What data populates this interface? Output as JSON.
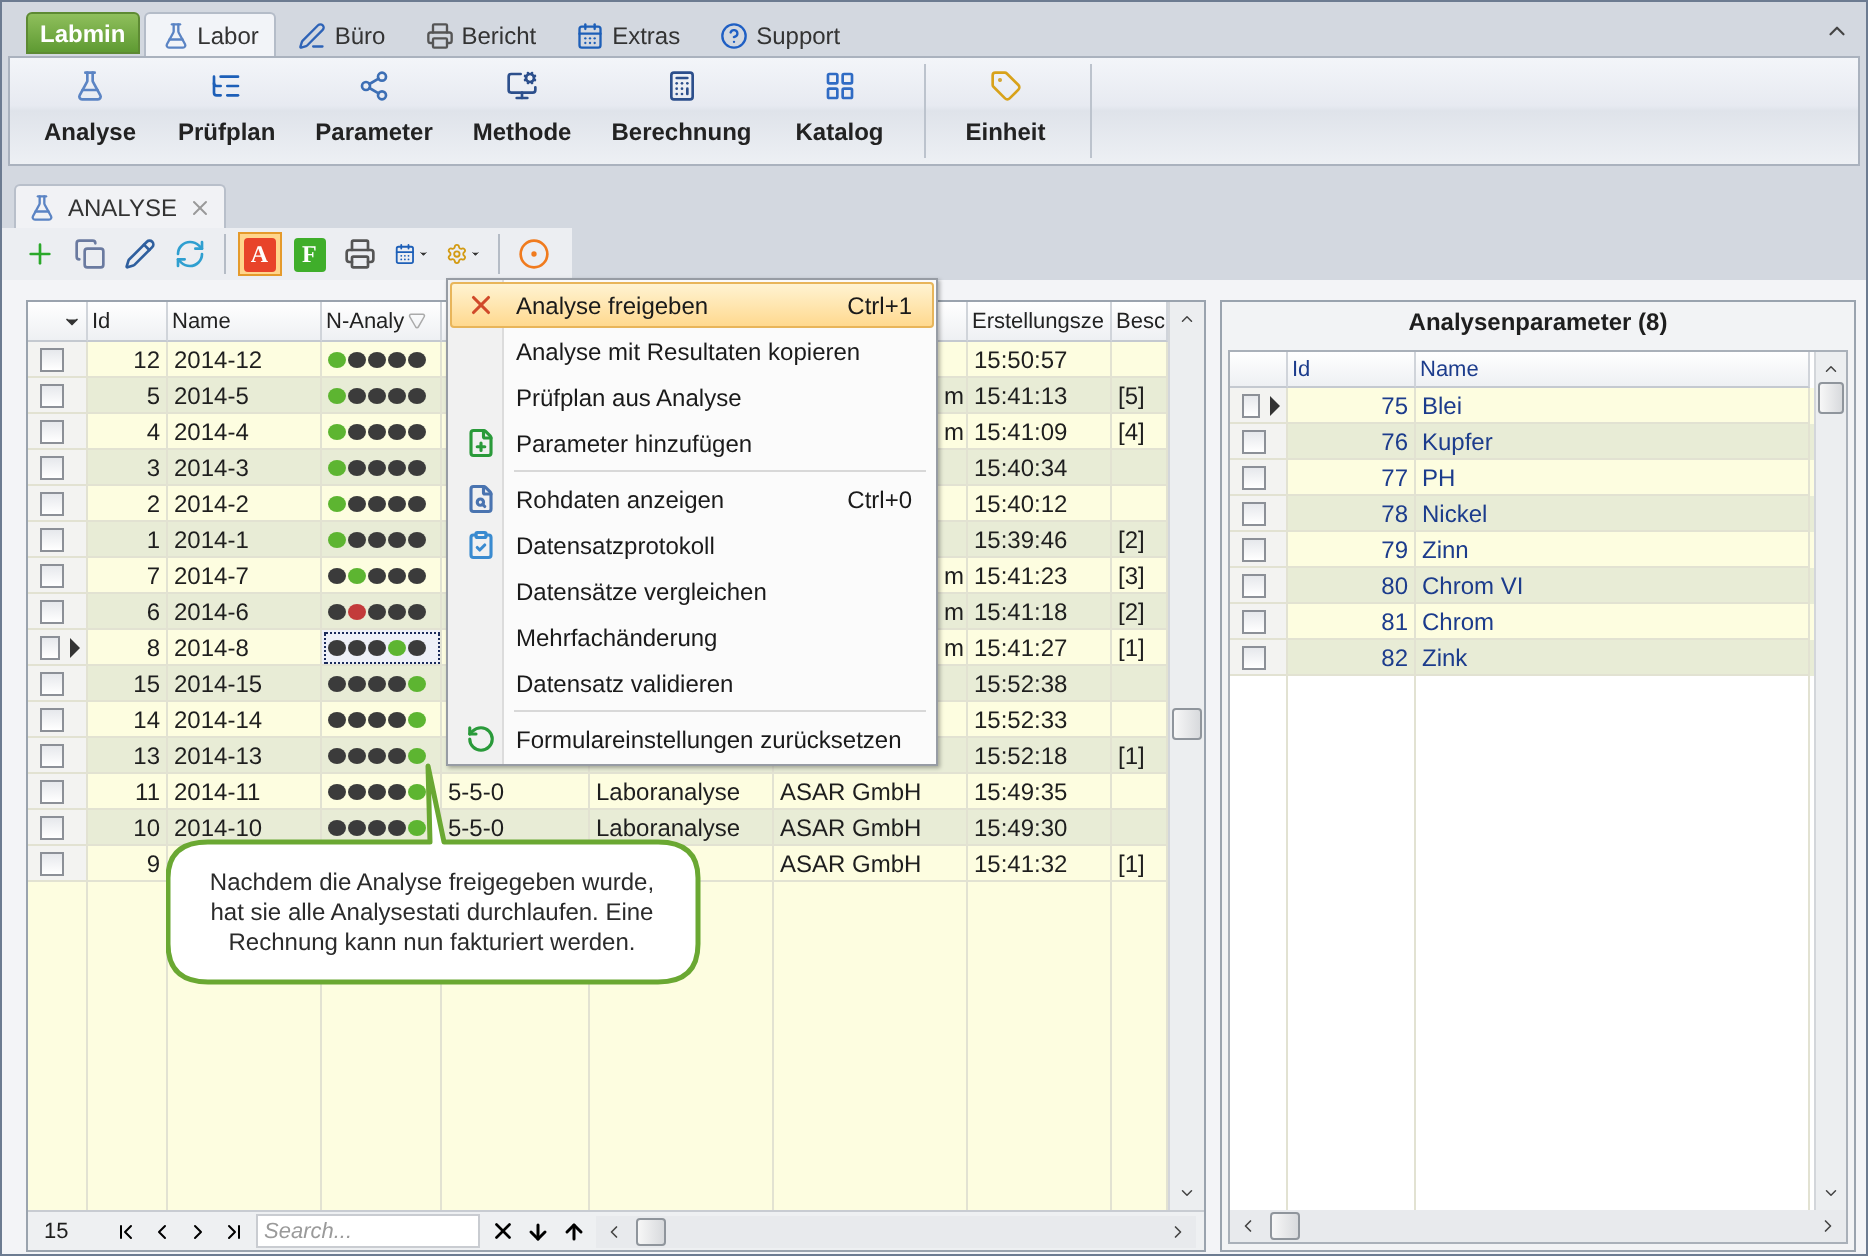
{
  "ribbon": {
    "app_button": "Labmin",
    "tabs": [
      {
        "label": "Labor",
        "selected": true
      },
      {
        "label": "Büro",
        "selected": false
      },
      {
        "label": "Bericht",
        "selected": false
      },
      {
        "label": "Extras",
        "selected": false
      },
      {
        "label": "Support",
        "selected": false
      }
    ],
    "groups": [
      {
        "buttons": [
          "Analyse",
          "Prüfplan",
          "Parameter",
          "Methode",
          "Berechnung",
          "Katalog"
        ]
      },
      {
        "buttons": [
          "Einheit"
        ]
      }
    ]
  },
  "document_tab": {
    "label": "ANALYSE",
    "selected": true
  },
  "toolbar": [
    {
      "kind": "icon",
      "pressed": false,
      "dropdown": false
    },
    {
      "kind": "icon",
      "pressed": false,
      "dropdown": false
    },
    {
      "kind": "icon",
      "pressed": false,
      "dropdown": false
    },
    {
      "kind": "icon",
      "pressed": false,
      "dropdown": false
    },
    {
      "kind": "separator"
    },
    {
      "kind": "letter",
      "label": "A",
      "color": "#e8432a",
      "pressed": true,
      "dropdown": false
    },
    {
      "kind": "letter",
      "label": "F",
      "color": "#3fae2a",
      "pressed": false,
      "dropdown": false
    },
    {
      "kind": "icon",
      "pressed": false,
      "dropdown": false
    },
    {
      "kind": "icon",
      "pressed": false,
      "dropdown": true
    },
    {
      "kind": "icon",
      "pressed": false,
      "dropdown": true
    },
    {
      "kind": "separator"
    },
    {
      "kind": "icon",
      "pressed": false,
      "dropdown": false
    }
  ],
  "main_grid": {
    "headers": {
      "id": "Id",
      "name": "Name",
      "status": "N-Analy",
      "created": "Erstellungsze",
      "note": "Besc"
    },
    "rows": [
      {
        "checked": false,
        "current": false,
        "id": "12",
        "name": "2014-12",
        "dots": [
          {
            "color": "#5db531"
          },
          {
            "color": "#3b3b3b"
          },
          {
            "color": "#3b3b3b"
          },
          {
            "color": "#3b3b3b"
          },
          {
            "color": "#3b3b3b"
          }
        ],
        "created": "15:50:57"
      },
      {
        "checked": false,
        "current": false,
        "id": "5",
        "name": "2014-5",
        "dots": [
          {
            "color": "#5db531"
          },
          {
            "color": "#3b3b3b"
          },
          {
            "color": "#3b3b3b"
          },
          {
            "color": "#3b3b3b"
          },
          {
            "color": "#3b3b3b"
          }
        ],
        "column_7": "m",
        "column_7_partial": true,
        "created": "15:41:13",
        "note": "[5]"
      },
      {
        "checked": false,
        "current": false,
        "id": "4",
        "name": "2014-4",
        "dots": [
          {
            "color": "#5db531"
          },
          {
            "color": "#3b3b3b"
          },
          {
            "color": "#3b3b3b"
          },
          {
            "color": "#3b3b3b"
          },
          {
            "color": "#3b3b3b"
          }
        ],
        "column_7": "m",
        "column_7_partial": true,
        "created": "15:41:09",
        "note": "[4]"
      },
      {
        "checked": false,
        "current": false,
        "id": "3",
        "name": "2014-3",
        "dots": [
          {
            "color": "#5db531"
          },
          {
            "color": "#3b3b3b"
          },
          {
            "color": "#3b3b3b"
          },
          {
            "color": "#3b3b3b"
          },
          {
            "color": "#3b3b3b"
          }
        ],
        "created": "15:40:34"
      },
      {
        "checked": false,
        "current": false,
        "id": "2",
        "name": "2014-2",
        "dots": [
          {
            "color": "#5db531"
          },
          {
            "color": "#3b3b3b"
          },
          {
            "color": "#3b3b3b"
          },
          {
            "color": "#3b3b3b"
          },
          {
            "color": "#3b3b3b"
          }
        ],
        "created": "15:40:12"
      },
      {
        "checked": false,
        "current": false,
        "id": "1",
        "name": "2014-1",
        "dots": [
          {
            "color": "#5db531"
          },
          {
            "color": "#3b3b3b"
          },
          {
            "color": "#3b3b3b"
          },
          {
            "color": "#3b3b3b"
          },
          {
            "color": "#3b3b3b"
          }
        ],
        "created": "15:39:46",
        "note": "[2]"
      },
      {
        "checked": false,
        "current": false,
        "id": "7",
        "name": "2014-7",
        "dots": [
          {
            "color": "#3b3b3b"
          },
          {
            "color": "#5db531"
          },
          {
            "color": "#3b3b3b"
          },
          {
            "color": "#3b3b3b"
          },
          {
            "color": "#3b3b3b"
          }
        ],
        "column_7": "m",
        "column_7_partial": true,
        "created": "15:41:23",
        "note": "[3]"
      },
      {
        "checked": false,
        "current": false,
        "id": "6",
        "name": "2014-6",
        "dots": [
          {
            "color": "#3b3b3b"
          },
          {
            "color": "#c33b3b"
          },
          {
            "color": "#3b3b3b"
          },
          {
            "color": "#3b3b3b"
          },
          {
            "color": "#3b3b3b"
          }
        ],
        "column_7": "m",
        "column_7_partial": true,
        "created": "15:41:18",
        "note": "[2]"
      },
      {
        "checked": false,
        "current": true,
        "id": "8",
        "name": "2014-8",
        "dots": [
          {
            "color": "#3b3b3b"
          },
          {
            "color": "#3b3b3b"
          },
          {
            "color": "#3b3b3b"
          },
          {
            "color": "#5db531"
          },
          {
            "color": "#3b3b3b"
          }
        ],
        "column_7": "m",
        "column_7_partial": true,
        "created": "15:41:27",
        "note": "[1]"
      },
      {
        "checked": false,
        "current": false,
        "id": "15",
        "name": "2014-15",
        "dots": [
          {
            "color": "#3b3b3b"
          },
          {
            "color": "#3b3b3b"
          },
          {
            "color": "#3b3b3b"
          },
          {
            "color": "#3b3b3b"
          },
          {
            "color": "#5db531"
          }
        ],
        "created": "15:52:38"
      },
      {
        "checked": false,
        "current": false,
        "id": "14",
        "name": "2014-14",
        "dots": [
          {
            "color": "#3b3b3b"
          },
          {
            "color": "#3b3b3b"
          },
          {
            "color": "#3b3b3b"
          },
          {
            "color": "#3b3b3b"
          },
          {
            "color": "#5db531"
          }
        ],
        "created": "15:52:33"
      },
      {
        "checked": false,
        "current": false,
        "id": "13",
        "name": "2014-13",
        "dots": [
          {
            "color": "#3b3b3b"
          },
          {
            "color": "#3b3b3b"
          },
          {
            "color": "#3b3b3b"
          },
          {
            "color": "#3b3b3b"
          },
          {
            "color": "#5db531"
          }
        ],
        "created": "15:52:18",
        "note": "[1]"
      },
      {
        "checked": false,
        "current": false,
        "id": "11",
        "name": "2014-11",
        "dots": [
          {
            "color": "#3b3b3b"
          },
          {
            "color": "#3b3b3b"
          },
          {
            "color": "#3b3b3b"
          },
          {
            "color": "#3b3b3b"
          },
          {
            "color": "#5db531"
          }
        ],
        "column_5": "5-5-0",
        "column_6": "Laboranalyse",
        "column_7": "ASAR GmbH",
        "created": "15:49:35"
      },
      {
        "checked": false,
        "current": false,
        "id": "10",
        "name": "2014-10",
        "dots": [
          {
            "color": "#3b3b3b"
          },
          {
            "color": "#3b3b3b"
          },
          {
            "color": "#3b3b3b"
          },
          {
            "color": "#3b3b3b"
          },
          {
            "color": "#5db531"
          }
        ],
        "column_5": "5-5-0",
        "column_6": "Laboranalyse",
        "column_7": "ASAR GmbH",
        "created": "15:49:30"
      },
      {
        "checked": false,
        "current": false,
        "id": "9",
        "column_7": "ASAR GmbH",
        "created": "15:41:32",
        "note": "[1]"
      }
    ],
    "record_count": "15",
    "search_placeholder": "Search..."
  },
  "context_menu": [
    {
      "kind": "item",
      "label": "Analyse freigeben",
      "shortcut": "Ctrl+1",
      "selected": true
    },
    {
      "kind": "item",
      "label": "Analyse mit Resultaten kopieren",
      "selected": false
    },
    {
      "kind": "item",
      "label": "Prüfplan aus Analyse",
      "selected": false
    },
    {
      "kind": "item",
      "label": "Parameter hinzufügen",
      "selected": false
    },
    {
      "kind": "separator"
    },
    {
      "kind": "item",
      "label": "Rohdaten anzeigen",
      "shortcut": "Ctrl+0",
      "selected": false
    },
    {
      "kind": "item",
      "label": "Datensatzprotokoll",
      "selected": false
    },
    {
      "kind": "item",
      "label": "Datensätze vergleichen",
      "selected": false
    },
    {
      "kind": "item",
      "label": "Mehrfachänderung",
      "selected": false
    },
    {
      "kind": "item",
      "label": "Datensatz validieren",
      "selected": false
    },
    {
      "kind": "separator"
    },
    {
      "kind": "item",
      "label": "Formulareinstellungen zurücksetzen",
      "selected": false
    }
  ],
  "callout": {
    "text": "Nachdem die Analyse freigegeben wurde, hat sie alle Analysestati durchlaufen. Eine Rechnung kann nun fakturiert werden."
  },
  "parameter_panel": {
    "title": "Analysenparameter (8)",
    "headers": {
      "id": "Id",
      "name": "Name"
    },
    "rows": [
      {
        "checked": false,
        "current": true,
        "id": "75",
        "name": "Blei"
      },
      {
        "checked": false,
        "current": false,
        "id": "76",
        "name": "Kupfer"
      },
      {
        "checked": false,
        "current": false,
        "id": "77",
        "name": "PH"
      },
      {
        "checked": false,
        "current": false,
        "id": "78",
        "name": "Nickel"
      },
      {
        "checked": false,
        "current": false,
        "id": "79",
        "name": "Zinn"
      },
      {
        "checked": false,
        "current": false,
        "id": "80",
        "name": "Chrom VI"
      },
      {
        "checked": false,
        "current": false,
        "id": "81",
        "name": "Chrom"
      },
      {
        "checked": false,
        "current": false,
        "id": "82",
        "name": "Zink"
      }
    ]
  }
}
